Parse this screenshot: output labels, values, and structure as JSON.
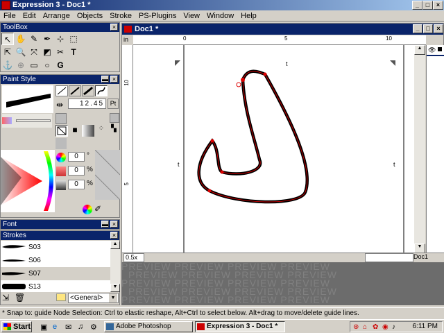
{
  "window": {
    "title": "Expression 3 - Doc1 *"
  },
  "menu": [
    "File",
    "Edit",
    "Arrange",
    "Objects",
    "Stroke",
    "PS-Plugins",
    "View",
    "Window",
    "Help"
  ],
  "toolbox": {
    "title": "ToolBox"
  },
  "paint_style": {
    "title": "Paint Style",
    "width_value": "12.45",
    "width_unit": "Pt",
    "angle_value": "0",
    "angle_unit": "°",
    "pct1_value": "0",
    "pct1_unit": "%",
    "pct2_value": "0",
    "pct2_unit": "%"
  },
  "font_panel": {
    "title": "Font"
  },
  "strokes_panel": {
    "title": "Strokes",
    "items": [
      "S03",
      "S06",
      "S07",
      "S13"
    ],
    "selected": "S07",
    "category": "<General>"
  },
  "document": {
    "title": "Doc1 *",
    "ruler_unit": "in",
    "ruler_h_ticks": [
      "0",
      "5",
      "10"
    ],
    "ruler_v_ticks": [
      "10",
      "5"
    ],
    "zoom": "0.5x",
    "page_label": "Doc1"
  },
  "preview": {
    "text": "PREVIEW"
  },
  "statusbar": {
    "text": "* Snap to: guide   Node Selection: Ctrl to elastic reshape, Alt+Ctrl to select below. Alt+drag to move/delete guide lines."
  },
  "taskbar": {
    "start": "Start",
    "tasks": [
      "Adobe Photoshop",
      "Expression 3 - Doc1 *"
    ],
    "clock": "6:11 PM"
  }
}
